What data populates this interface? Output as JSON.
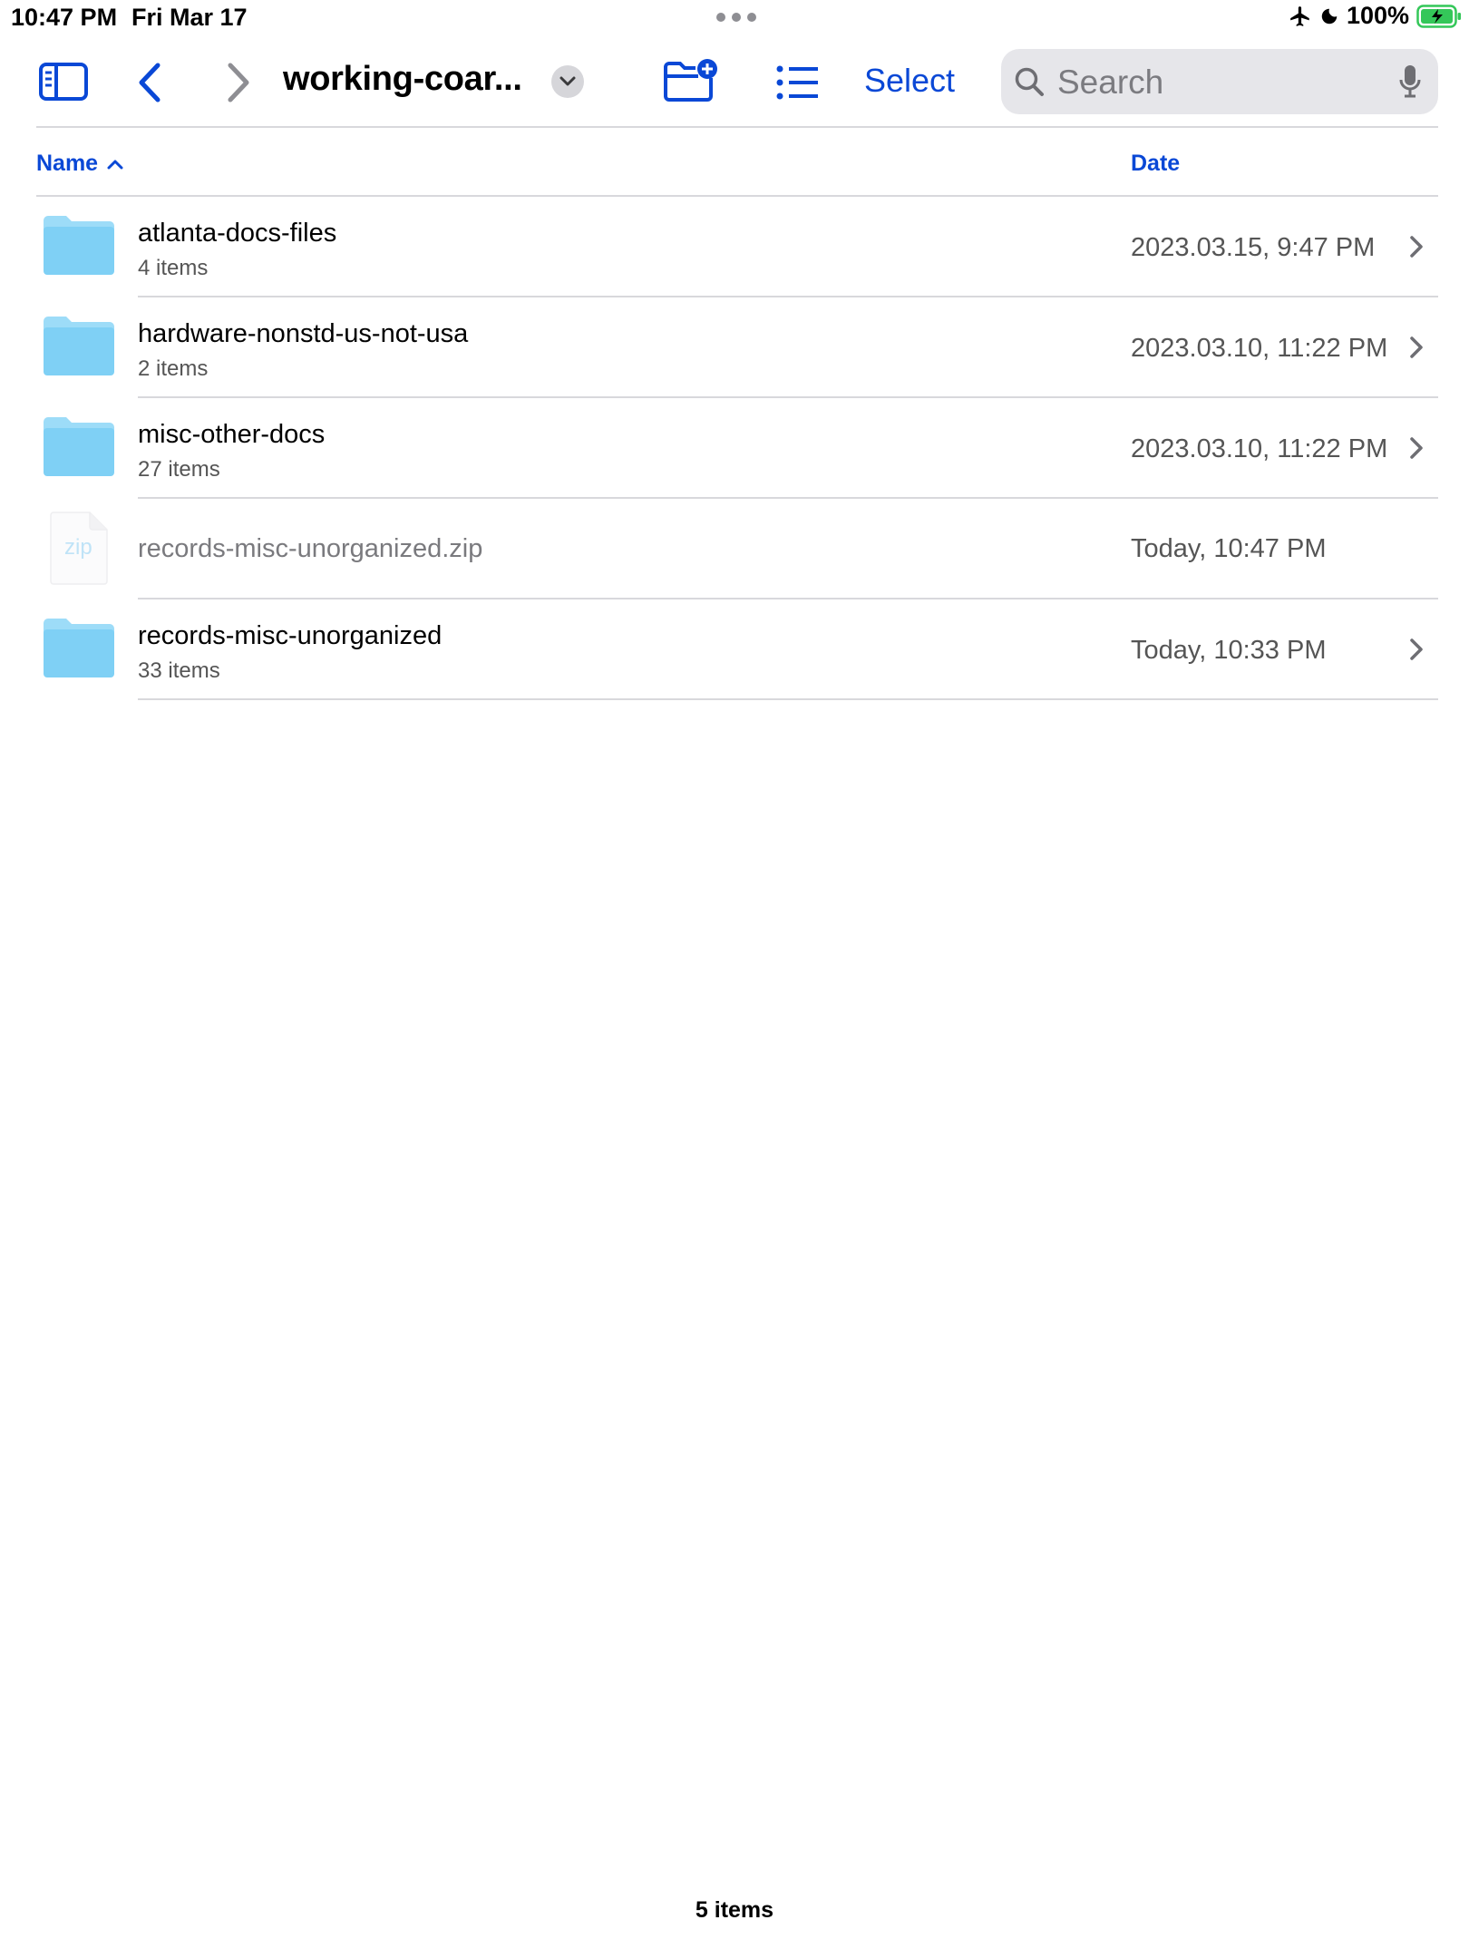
{
  "status_bar": {
    "time": "10:47 PM",
    "date": "Fri Mar 17",
    "battery_percent": "100%",
    "battery_level": 1.0
  },
  "toolbar": {
    "folder_title": "working-coar...",
    "select_label": "Select",
    "search_placeholder": "Search"
  },
  "columns": {
    "name": "Name",
    "date": "Date",
    "sort": "ascending"
  },
  "files": [
    {
      "name": "atlanta-docs-files",
      "count": "4 items",
      "date": "2023.03.15, 9:47 PM",
      "type": "folder"
    },
    {
      "name": "hardware-nonstd-us-not-usa",
      "count": "2 items",
      "date": "2023.03.10, 11:22 PM",
      "type": "folder"
    },
    {
      "name": "misc-other-docs",
      "count": "27 items",
      "date": "2023.03.10, 11:22 PM",
      "type": "folder"
    },
    {
      "name": "records-misc-unorganized.zip",
      "count": "",
      "date": "Today, 10:47 PM",
      "type": "zip",
      "icon_label": "zip"
    },
    {
      "name": "records-misc-unorganized",
      "count": "33 items",
      "date": "Today, 10:33 PM",
      "type": "folder"
    }
  ],
  "footer": {
    "item_count": "5 items"
  },
  "colors": {
    "accent": "#0a48d6",
    "folder": "#7fd0f5",
    "battery": "#34c759"
  }
}
